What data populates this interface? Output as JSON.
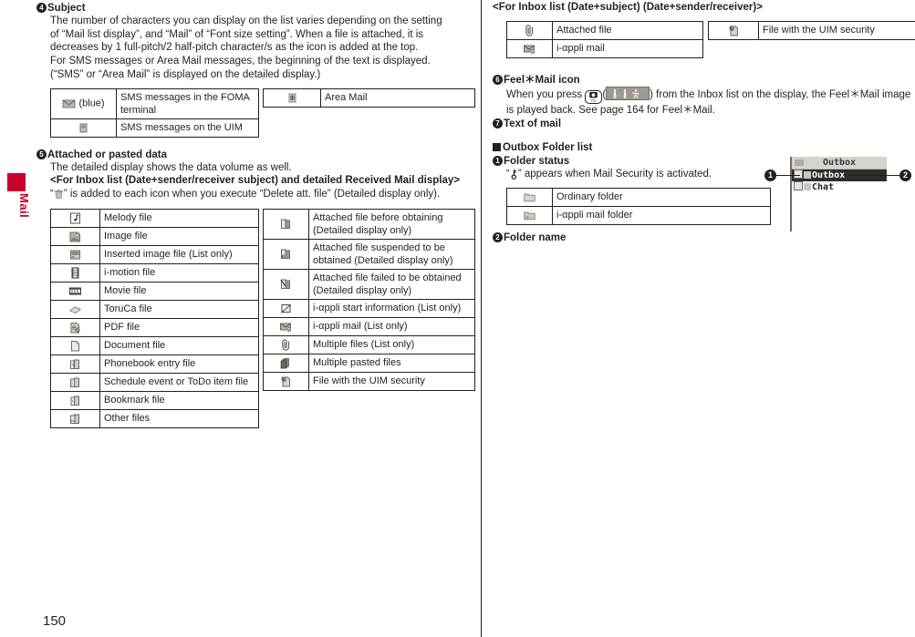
{
  "page": {
    "number": "150",
    "side_tab_label": "Mail"
  },
  "left_column": {
    "section4": {
      "bullet": "4",
      "heading": "Subject",
      "paragraphs": [
        "The number of characters you can display on the list varies depending on the setting",
        "of “Mail list display”, and “Mail” of “Font size setting”. When a file is attached, it is",
        "decreases by 1 full-pitch/2 half-pitch character/s as the icon is added at the top.",
        "For SMS messages or Area Mail messages, the beginning of the text is displayed.",
        "(“SMS” or “Area Mail” is displayed on the detailed display.)"
      ],
      "table_left": [
        {
          "icon": "envelope-blue-icon",
          "suffix": "(blue)",
          "label": "SMS messages in the FOMA terminal"
        },
        {
          "icon": "uim-card-icon",
          "suffix": "",
          "label": "SMS messages on the UIM"
        }
      ],
      "table_right": [
        {
          "icon": "area-mail-icon",
          "label": "Area Mail"
        }
      ]
    },
    "section5": {
      "bullet": "5",
      "heading": "Attached or pasted data",
      "paragraphs": [
        "The detailed display shows the data volume as well."
      ],
      "sub_heading": "<For Inbox list (Date+sender/receiver subject) and detailed Received Mail display>",
      "note_prefix": "“",
      "note_icon": "trash-icon",
      "note_suffix": "” is added to each icon when you execute “Delete att. file” (Detailed display only).",
      "table_left": [
        {
          "icon": "melody-file-icon",
          "label": "Melody file"
        },
        {
          "icon": "image-file-icon",
          "label": "Image file"
        },
        {
          "icon": "inserted-image-file-icon",
          "label": "Inserted image file (List only)"
        },
        {
          "icon": "i-motion-file-icon",
          "label": "i-motion file"
        },
        {
          "icon": "movie-file-icon",
          "label": "Movie file"
        },
        {
          "icon": "toruca-file-icon",
          "label": "ToruCa file"
        },
        {
          "icon": "pdf-file-icon",
          "label": "PDF file"
        },
        {
          "icon": "document-file-icon",
          "label": "Document file"
        },
        {
          "icon": "phonebook-entry-file-icon",
          "label": "Phonebook entry file"
        },
        {
          "icon": "schedule-todo-file-icon",
          "label": "Schedule event or ToDo item file"
        },
        {
          "icon": "bookmark-file-icon",
          "label": "Bookmark file"
        },
        {
          "icon": "other-files-icon",
          "label": "Other files"
        }
      ],
      "table_right": [
        {
          "icon": "attached-file-before-obtaining-icon",
          "label": "Attached file before obtaining (Detailed display only)"
        },
        {
          "icon": "attached-file-suspended-icon",
          "label": "Attached file suspended to be obtained (Detailed display only)"
        },
        {
          "icon": "attached-file-failed-icon",
          "label": "Attached file failed to be obtained (Detailed display only)"
        },
        {
          "icon": "i-appli-start-information-icon",
          "label": "i-αppli start information (List only)"
        },
        {
          "icon": "i-appli-mail-icon",
          "label": "i-αppli mail (List only)"
        },
        {
          "icon": "multiple-files-icon",
          "label": "Multiple files (List only)"
        },
        {
          "icon": "multiple-pasted-files-icon",
          "label": "Multiple pasted files"
        },
        {
          "icon": "uim-security-file-icon",
          "label": "File with the UIM security"
        }
      ]
    }
  },
  "right_column": {
    "inbox_list_heading": "<For Inbox list (Date+subject) (Date+sender/receiver)>",
    "inbox_table_left": [
      {
        "icon": "attached-file-icon",
        "label": "Attached file"
      },
      {
        "icon": "i-appli-mail-icon",
        "label": "i-αppli mail"
      }
    ],
    "inbox_table_right": [
      {
        "icon": "uim-security-file-icon",
        "label": "File with the UIM security"
      }
    ],
    "section6": {
      "bullet": "6",
      "heading": "Feel＊Mail icon",
      "line1_a": "When you press",
      "key_icon": "camera-tv-key-icon",
      "image_icon": "feel-mail-image-icon",
      "line1_b": ") from the Inbox list on the display, the Feel＊Mail image",
      "line2": "is played back. See page 164 for Feel＊Mail."
    },
    "section7": {
      "bullet": "7",
      "heading": "Text of mail"
    },
    "outbox": {
      "square_heading": "Outbox Folder list",
      "section1": {
        "bullet": "1",
        "heading": "Folder status",
        "note_prefix": "“",
        "note_icon": "mail-security-key-icon",
        "note_suffix": "” appears when Mail Security is activated.",
        "table": [
          {
            "icon": "ordinary-folder-icon",
            "label": "Ordinary folder"
          },
          {
            "icon": "i-appli-mail-folder-icon",
            "label": "i-αppli mail folder"
          }
        ]
      },
      "section2": {
        "bullet": "2",
        "heading": "Folder name"
      }
    },
    "phone_mock": {
      "title": "Outbox",
      "rows": [
        {
          "label": "Outbox",
          "selected": true
        },
        {
          "label": "Chat",
          "selected": false
        }
      ],
      "callout_left": "1",
      "callout_right": "2"
    }
  },
  "colors": {
    "tab_red": "#c8002f",
    "ink": "#231f20",
    "icon_gray": "#9e9a93"
  }
}
